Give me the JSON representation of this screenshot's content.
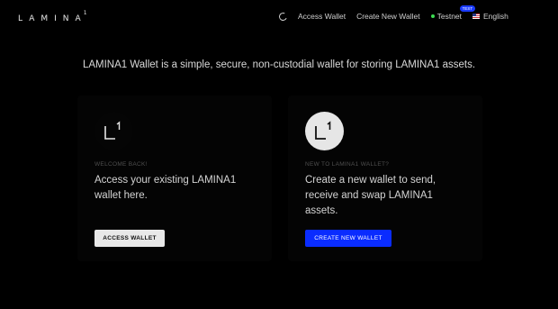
{
  "header": {
    "logo_text": "LAMINA",
    "logo_sup": "1",
    "nav": {
      "access_wallet": "Access Wallet",
      "create_wallet": "Create New Wallet",
      "network": "Testnet",
      "network_badge": "TEST",
      "language": "English"
    }
  },
  "main": {
    "tagline": "LAMINA1 Wallet is a simple, secure, non-custodial wallet for storing LAMINA1 assets.",
    "cards": [
      {
        "eyebrow": "WELCOME BACK!",
        "description": "Access your existing LAMINA1 wallet here.",
        "button": "ACCESS WALLET"
      },
      {
        "eyebrow": "NEW TO LAMINA1 WALLET?",
        "description": "Create a new wallet to send, receive and swap LAMINA1 assets.",
        "button": "CREATE NEW WALLET"
      }
    ]
  },
  "colors": {
    "accent_blue": "#0a2cff",
    "status_green": "#3ddc52",
    "background": "#000000"
  },
  "icons": [
    "moon-icon",
    "status-dot-icon",
    "us-flag-icon",
    "lamina1-logo-icon"
  ]
}
